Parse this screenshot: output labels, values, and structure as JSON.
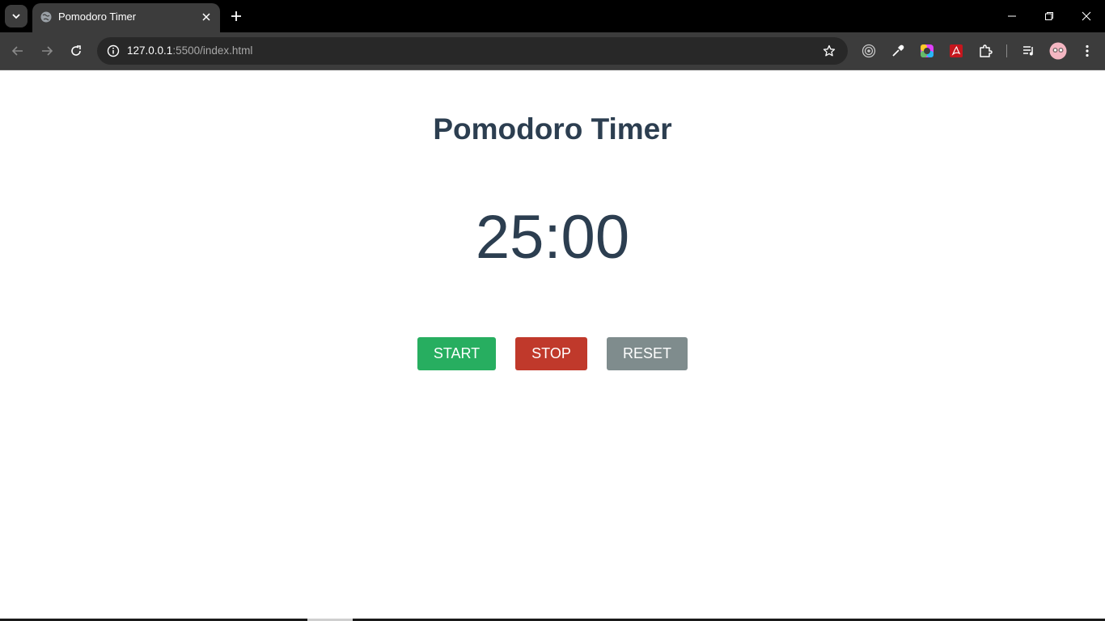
{
  "browser": {
    "tab_title": "Pomodoro Timer",
    "url_host": "127.0.0.1",
    "url_rest": ":5500/index.html"
  },
  "page": {
    "title": "Pomodoro Timer",
    "timer": "25:00",
    "buttons": {
      "start": "START",
      "stop": "STOP",
      "reset": "RESET"
    }
  },
  "colors": {
    "text": "#2c3e50",
    "start": "#27ae60",
    "stop": "#c0392b",
    "reset": "#7f8c8d"
  },
  "icons": [
    "tab-search-icon",
    "globe-icon",
    "close-icon",
    "plus-icon",
    "minimize-icon",
    "restore-icon",
    "window-close-icon",
    "back-icon",
    "forward-icon",
    "reload-icon",
    "info-icon",
    "star-icon",
    "target-icon",
    "eyedropper-icon",
    "color-wheel-icon",
    "pdf-icon",
    "extensions-icon",
    "media-icon",
    "profile-avatar-icon",
    "more-icon"
  ]
}
